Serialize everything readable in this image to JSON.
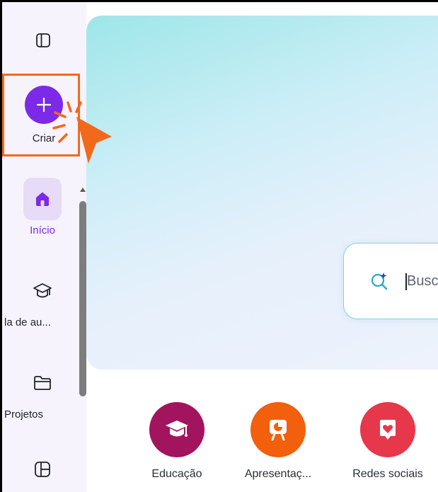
{
  "sidebar": {
    "create_label": "Criar",
    "nav": [
      {
        "label": "Início",
        "icon": "home-icon",
        "active": true
      },
      {
        "label": "la de au...",
        "icon": "graduation-cap-icon",
        "active": false
      },
      {
        "label": "Projetos",
        "icon": "folder-icon",
        "active": false
      },
      {
        "label": "",
        "icon": "templates-icon",
        "active": false
      }
    ]
  },
  "search": {
    "placeholder": "Busca"
  },
  "categories": [
    {
      "label": "Educação",
      "icon": "graduation-cap-icon",
      "color": "#a3145e"
    },
    {
      "label": "Apresentaç...",
      "icon": "presentation-icon",
      "color": "#f25f0d"
    },
    {
      "label": "Redes sociais",
      "icon": "heart-icon",
      "color": "#e6384a"
    }
  ],
  "colors": {
    "brand": "#7d2ae8",
    "highlight": "#f2691c"
  }
}
